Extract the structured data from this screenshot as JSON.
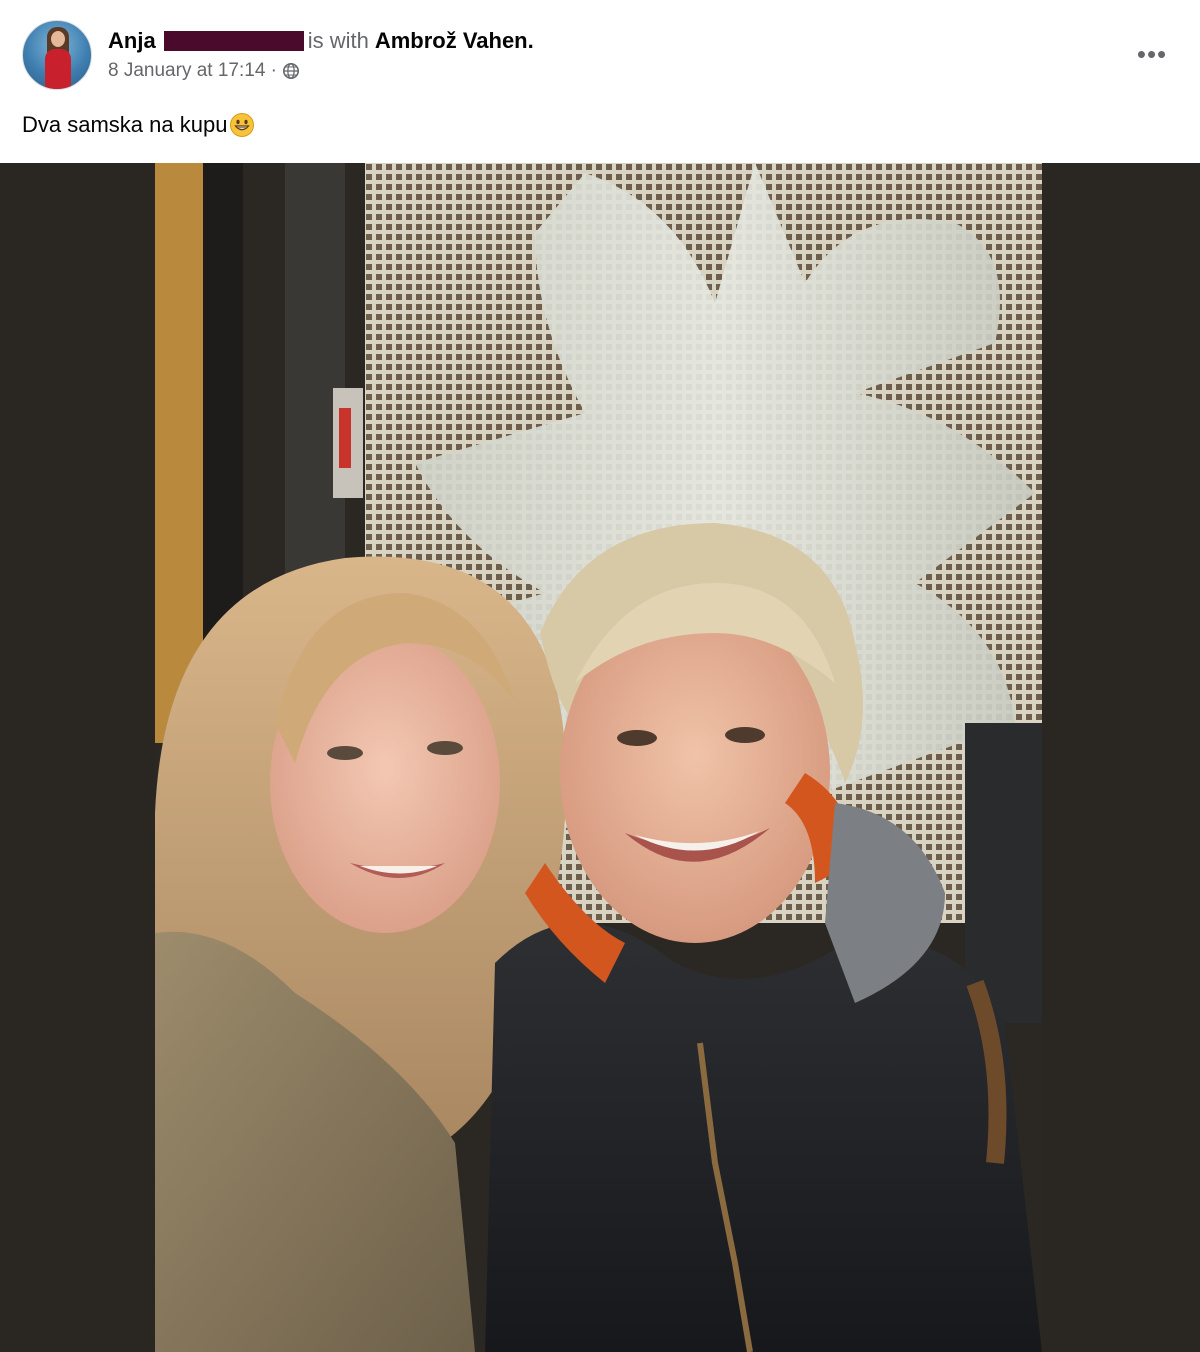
{
  "post": {
    "author": "Anja",
    "with_text": "is with",
    "tagged_person": "Ambrož Vahen.",
    "timestamp": "8 January at 17:14 ·",
    "privacy_icon": "globe-icon",
    "more_icon": "more-options-icon",
    "more_label": "•••",
    "caption": "Dva samska na kupu",
    "caption_emoji": "grinning-face-icon"
  },
  "colors": {
    "redaction": "#4a0a2c",
    "secondary_text": "#65676b",
    "primary_text": "#050505",
    "photo_letterbox": "#2a2622"
  }
}
